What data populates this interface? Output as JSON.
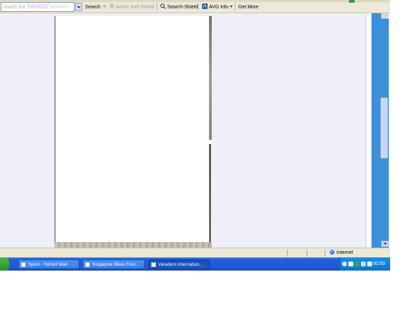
{
  "toolbar": {
    "search_placeholder_prefix": "search the",
    "search_brand": "YAHOO!",
    "search_brand_suffix": "SEARCH",
    "search_label": "Search",
    "active_shield_label": "Active Surf-Shield",
    "search_shield_label": "Search-Shield",
    "avg_info_label": "AVG Info",
    "get_more_label": "Get More"
  },
  "statusbar": {
    "zone_label": "Internet"
  },
  "taskbar": {
    "tasks": [
      {
        "label": "Spam - Yahoo! Mail - ..."
      },
      {
        "label": "Singapore Bikes Foru..."
      },
      {
        "label": "Varadero Internation..."
      }
    ],
    "clock": "00:50"
  },
  "colors": {
    "taskbar_blue": "#245edb",
    "scroll_blue": "#3c8fd9",
    "page_background": "#eeeff8"
  }
}
